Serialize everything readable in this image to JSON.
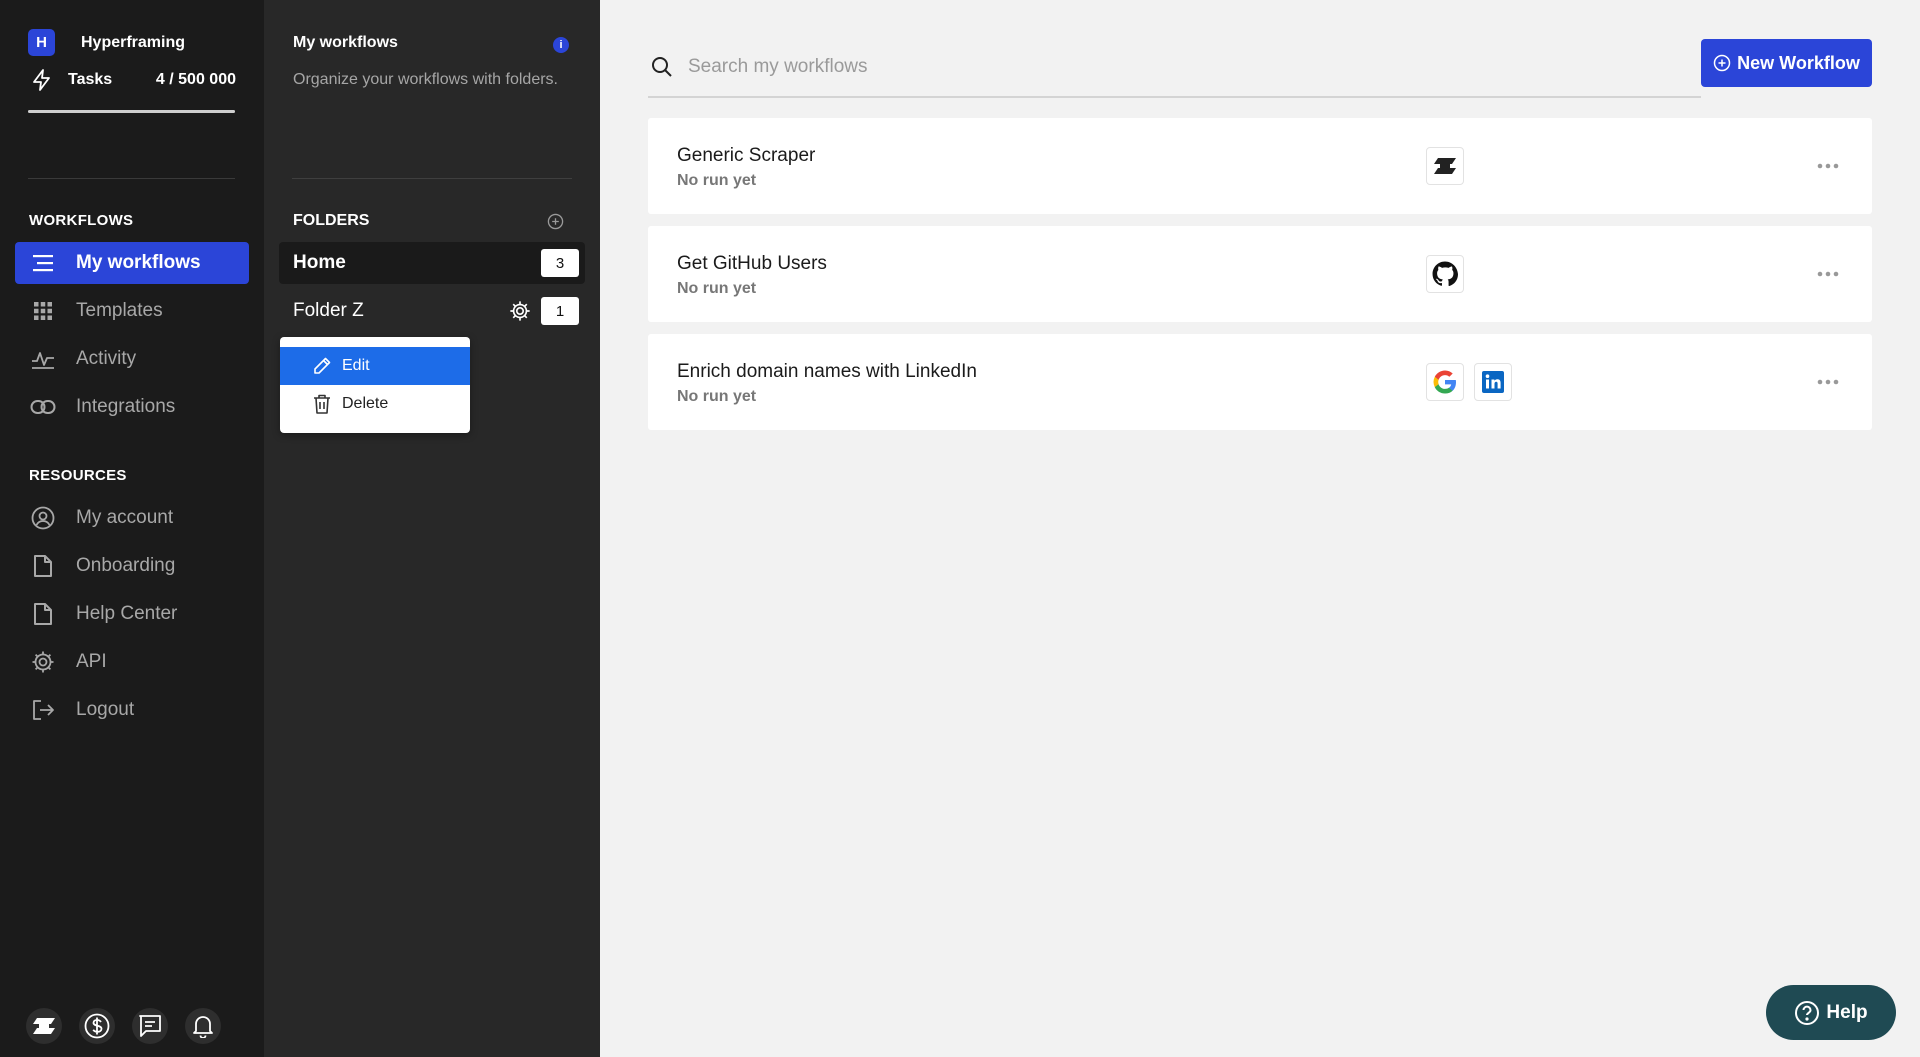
{
  "workspace": {
    "initial": "H",
    "name": "Hyperframing"
  },
  "tasks": {
    "label": "Tasks",
    "count": "4 / 500 000",
    "used": 4,
    "limit": 500000
  },
  "sidebar": {
    "workflows_heading": "WORKFLOWS",
    "workflow_items": [
      {
        "label": "My workflows",
        "icon": "list-icon",
        "active": true
      },
      {
        "label": "Templates",
        "icon": "grid-icon"
      },
      {
        "label": "Activity",
        "icon": "activity-icon"
      },
      {
        "label": "Integrations",
        "icon": "link-icon"
      }
    ],
    "resources_heading": "RESOURCES",
    "resource_items": [
      {
        "label": "My account",
        "icon": "user-circle-icon"
      },
      {
        "label": "Onboarding",
        "icon": "document-icon"
      },
      {
        "label": "Help Center",
        "icon": "document-icon"
      },
      {
        "label": "API",
        "icon": "gear-icon"
      },
      {
        "label": "Logout",
        "icon": "logout-icon"
      }
    ],
    "bottom_icons": [
      "brand-logo-icon",
      "dollar-icon",
      "chat-icon",
      "bell-icon"
    ]
  },
  "folder_panel": {
    "title": "My workflows",
    "info_glyph": "i",
    "description": "Organize your workflows with folders.",
    "folders_heading": "FOLDERS",
    "folders": [
      {
        "name": "Home",
        "count": "3",
        "active": true
      },
      {
        "name": "Folder Z",
        "count": "1"
      }
    ],
    "context_menu": [
      {
        "label": "Edit",
        "icon": "pencil-icon",
        "highlighted": true
      },
      {
        "label": "Delete",
        "icon": "trash-icon"
      }
    ]
  },
  "main": {
    "search_placeholder": "Search my workflows",
    "new_workflow_label": "New Workflow",
    "workflows": [
      {
        "name": "Generic Scraper",
        "status": "No run yet",
        "apps": [
          "brand-logo-icon"
        ]
      },
      {
        "name": "Get GitHub Users",
        "status": "No run yet",
        "apps": [
          "github-icon"
        ]
      },
      {
        "name": "Enrich domain names with LinkedIn",
        "status": "No run yet",
        "apps": [
          "google-icon",
          "linkedin-icon"
        ]
      }
    ],
    "help_label": "Help"
  },
  "colors": {
    "accent": "#2b45d8",
    "sidebar_bg": "#1b1b1b",
    "panel_bg": "#282828",
    "help_bg": "#1f4a53",
    "menu_highlight": "#1d6ce8"
  }
}
